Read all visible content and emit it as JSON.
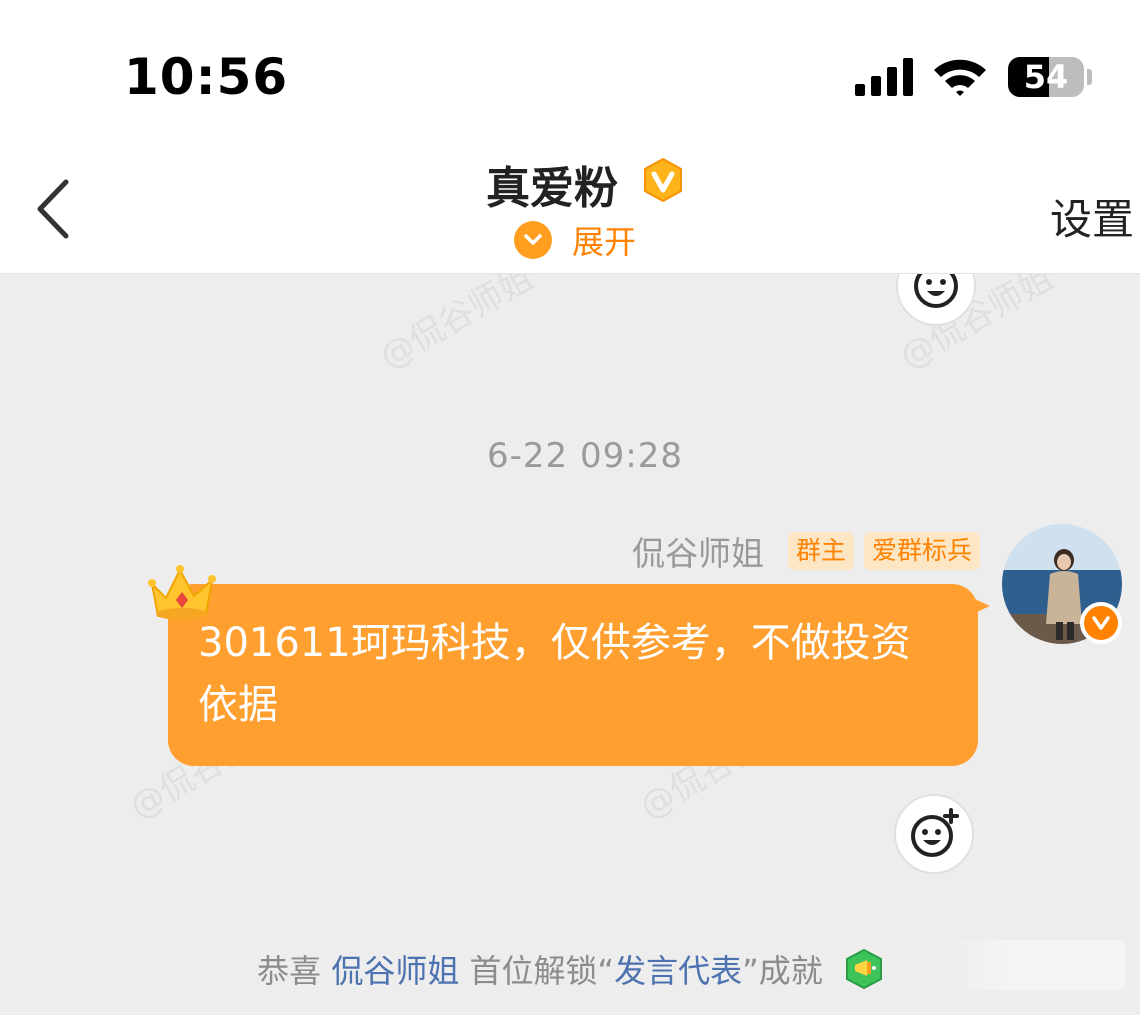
{
  "status_bar": {
    "time": "10:56",
    "battery_level": "54",
    "battery_fraction": 0.54
  },
  "header": {
    "title": "真爱粉",
    "expand_label": "展开",
    "settings_label": "设置"
  },
  "chat": {
    "timestamp": "6-22 09:28",
    "message": {
      "sender": "侃谷师姐",
      "tags": [
        "群主",
        "爱群标兵"
      ],
      "text": "301611珂玛科技，仅供参考，不做投资依据"
    },
    "watermark_text": "@侃谷师姐"
  },
  "notice": {
    "prefix": "恭喜",
    "user": "侃谷师姐",
    "middle": "首位解锁",
    "quote_open": "“",
    "achievement": "发言代表",
    "quote_close": "”",
    "suffix": "成就"
  },
  "colors": {
    "accent": "#ff8200",
    "bubble": "#ff9f30",
    "background": "#ededed",
    "link": "#4c72b0"
  },
  "icons": [
    "signal-icon",
    "wifi-icon",
    "battery-icon",
    "back-arrow-icon",
    "verified-badge-icon",
    "chevron-down-icon",
    "emoji-reaction-icon",
    "crown-icon",
    "avatar-verified-icon",
    "trophy-icon"
  ]
}
